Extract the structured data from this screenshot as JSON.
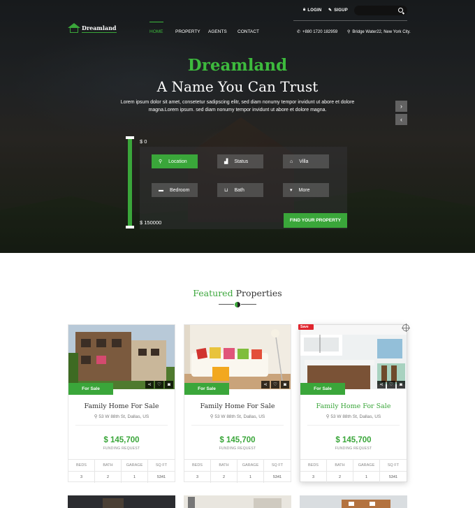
{
  "header": {
    "login": "LOGIN",
    "signup": "SIGUP",
    "logo_text": "Dreamland",
    "nav": [
      "HOME",
      "PROPERTY",
      "AGENTS",
      "CONTACT"
    ],
    "phone": "+880 1720 182959",
    "address": "Bridge Water22, New York City."
  },
  "hero": {
    "title": "Dreamland",
    "subtitle": "A Name You Can Trust",
    "description": "Lorem ipsum dolor sit amet, consetetur sadipscing elitr, sed diam nonumy tempor invidunt ut abore et dolore magna.Lorem ipsum. sed diam nonumy tempor invidunt ut abore et dolore magna.",
    "next_arrow": "›",
    "prev_arrow": "‹"
  },
  "search": {
    "price_min": "$ 0",
    "price_max": "$ 150000",
    "location": "Location",
    "status": "Status",
    "villa": "Villa",
    "bedroom": "Bedroom",
    "bath": "Bath",
    "more": "More",
    "find_button": "FIND YOUR PROPERTY"
  },
  "featured": {
    "title_green": "Featured",
    "title_rest": "Properties",
    "save_badge": "Save",
    "cards": [
      {
        "tag": "For Sale",
        "title": "Family Home For Sale",
        "address": "53 W 88th St, Dallas, US",
        "price": "$ 145,700",
        "funding": "FUNDING REQUEST",
        "specs": [
          {
            "label": "BEDS",
            "value": "3"
          },
          {
            "label": "BATH",
            "value": "2"
          },
          {
            "label": "GARAGE",
            "value": "1"
          },
          {
            "label": "SQ FT",
            "value": "5341"
          }
        ]
      },
      {
        "tag": "For Sale",
        "title": "Family Home For Sale",
        "address": "53 W 88th St, Dallas, US",
        "price": "$ 145,700",
        "funding": "FUNDING REQUEST",
        "specs": [
          {
            "label": "BEDS",
            "value": "3"
          },
          {
            "label": "BATH",
            "value": "2"
          },
          {
            "label": "GARAGE",
            "value": "1"
          },
          {
            "label": "SQ FT",
            "value": "5341"
          }
        ]
      },
      {
        "tag": "For Sale",
        "title": "Family Home For Sale",
        "address": "53 W 88th St, Dallas, US",
        "price": "$ 145,700",
        "funding": "FUNDING REQUEST",
        "specs": [
          {
            "label": "BEDS",
            "value": "3"
          },
          {
            "label": "BATH",
            "value": "2"
          },
          {
            "label": "GARAGE",
            "value": "1"
          },
          {
            "label": "SQ FT",
            "value": "5341"
          }
        ]
      }
    ]
  },
  "colors": {
    "accent": "#3aa63a",
    "save_red": "#e0262f"
  }
}
